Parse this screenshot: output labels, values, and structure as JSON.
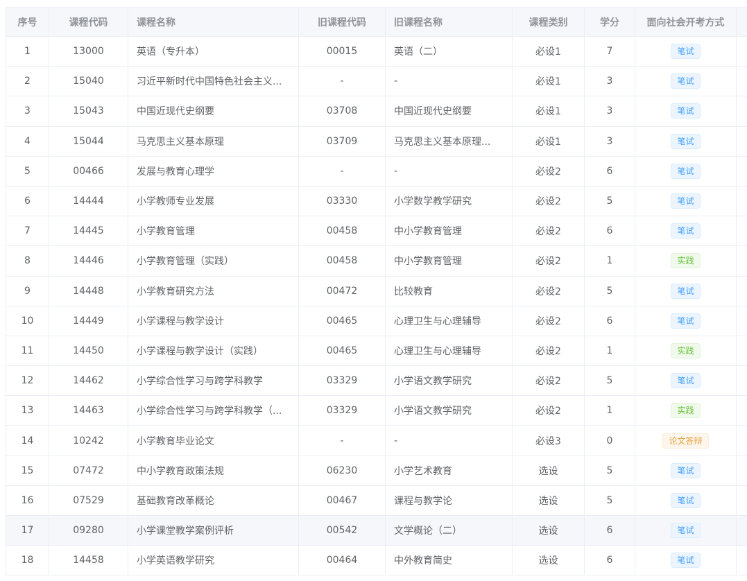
{
  "table": {
    "headers": [
      "序号",
      "课程代码",
      "课程名称",
      "旧课程代码",
      "旧课程名称",
      "课程类别",
      "学分",
      "面向社会开考方式"
    ],
    "rows": [
      {
        "no": "1",
        "code": "13000",
        "name": "英语（专升本）",
        "old_code": "00015",
        "old_name": "英语（二）",
        "category": "必设1",
        "credit": "7",
        "exam": "笔试",
        "exam_color": "blue"
      },
      {
        "no": "2",
        "code": "15040",
        "name": "习近平新时代中国特色社会主义...",
        "old_code": "-",
        "old_name": "-",
        "category": "必设1",
        "credit": "3",
        "exam": "笔试",
        "exam_color": "blue"
      },
      {
        "no": "3",
        "code": "15043",
        "name": "中国近现代史纲要",
        "old_code": "03708",
        "old_name": "中国近现代史纲要",
        "category": "必设1",
        "credit": "3",
        "exam": "笔试",
        "exam_color": "blue"
      },
      {
        "no": "4",
        "code": "15044",
        "name": "马克思主义基本原理",
        "old_code": "03709",
        "old_name": "马克思主义基本原理...",
        "category": "必设1",
        "credit": "3",
        "exam": "笔试",
        "exam_color": "blue"
      },
      {
        "no": "5",
        "code": "00466",
        "name": "发展与教育心理学",
        "old_code": "-",
        "old_name": "-",
        "category": "必设2",
        "credit": "6",
        "exam": "笔试",
        "exam_color": "blue"
      },
      {
        "no": "6",
        "code": "14444",
        "name": "小学教师专业发展",
        "old_code": "03330",
        "old_name": "小学数学教学研究",
        "category": "必设2",
        "credit": "5",
        "exam": "笔试",
        "exam_color": "blue"
      },
      {
        "no": "7",
        "code": "14445",
        "name": "小学教育管理",
        "old_code": "00458",
        "old_name": "中小学教育管理",
        "category": "必设2",
        "credit": "6",
        "exam": "笔试",
        "exam_color": "blue"
      },
      {
        "no": "8",
        "code": "14446",
        "name": "小学教育管理（实践）",
        "old_code": "00458",
        "old_name": "中小学教育管理",
        "category": "必设2",
        "credit": "1",
        "exam": "实践",
        "exam_color": "green"
      },
      {
        "no": "9",
        "code": "14448",
        "name": "小学教育研究方法",
        "old_code": "00472",
        "old_name": "比较教育",
        "category": "必设2",
        "credit": "5",
        "exam": "笔试",
        "exam_color": "blue"
      },
      {
        "no": "10",
        "code": "14449",
        "name": "小学课程与教学设计",
        "old_code": "00465",
        "old_name": "心理卫生与心理辅导",
        "category": "必设2",
        "credit": "6",
        "exam": "笔试",
        "exam_color": "blue"
      },
      {
        "no": "11",
        "code": "14450",
        "name": "小学课程与教学设计（实践）",
        "old_code": "00465",
        "old_name": "心理卫生与心理辅导",
        "category": "必设2",
        "credit": "1",
        "exam": "实践",
        "exam_color": "green"
      },
      {
        "no": "12",
        "code": "14462",
        "name": "小学综合性学习与跨学科教学",
        "old_code": "03329",
        "old_name": "小学语文教学研究",
        "category": "必设2",
        "credit": "5",
        "exam": "笔试",
        "exam_color": "blue"
      },
      {
        "no": "13",
        "code": "14463",
        "name": "小学综合性学习与跨学科教学（...",
        "old_code": "03329",
        "old_name": "小学语文教学研究",
        "category": "必设2",
        "credit": "1",
        "exam": "实践",
        "exam_color": "green"
      },
      {
        "no": "14",
        "code": "10242",
        "name": "小学教育毕业论文",
        "old_code": "-",
        "old_name": "-",
        "category": "必设3",
        "credit": "0",
        "exam": "论文答辩",
        "exam_color": "orange"
      },
      {
        "no": "15",
        "code": "07472",
        "name": "中小学教育政策法规",
        "old_code": "06230",
        "old_name": "小学艺术教育",
        "category": "选设",
        "credit": "5",
        "exam": "笔试",
        "exam_color": "blue"
      },
      {
        "no": "16",
        "code": "07529",
        "name": "基础教育改革概论",
        "old_code": "00467",
        "old_name": "课程与教学论",
        "category": "选设",
        "credit": "5",
        "exam": "笔试",
        "exam_color": "blue"
      },
      {
        "no": "17",
        "code": "09280",
        "name": "小学课堂教学案例评析",
        "old_code": "00542",
        "old_name": "文学概论（二）",
        "category": "选设",
        "credit": "6",
        "exam": "笔试",
        "exam_color": "blue"
      },
      {
        "no": "18",
        "code": "14458",
        "name": "小学英语教学研究",
        "old_code": "00464",
        "old_name": "中外教育简史",
        "category": "选设",
        "credit": "6",
        "exam": "笔试",
        "exam_color": "blue"
      }
    ]
  }
}
